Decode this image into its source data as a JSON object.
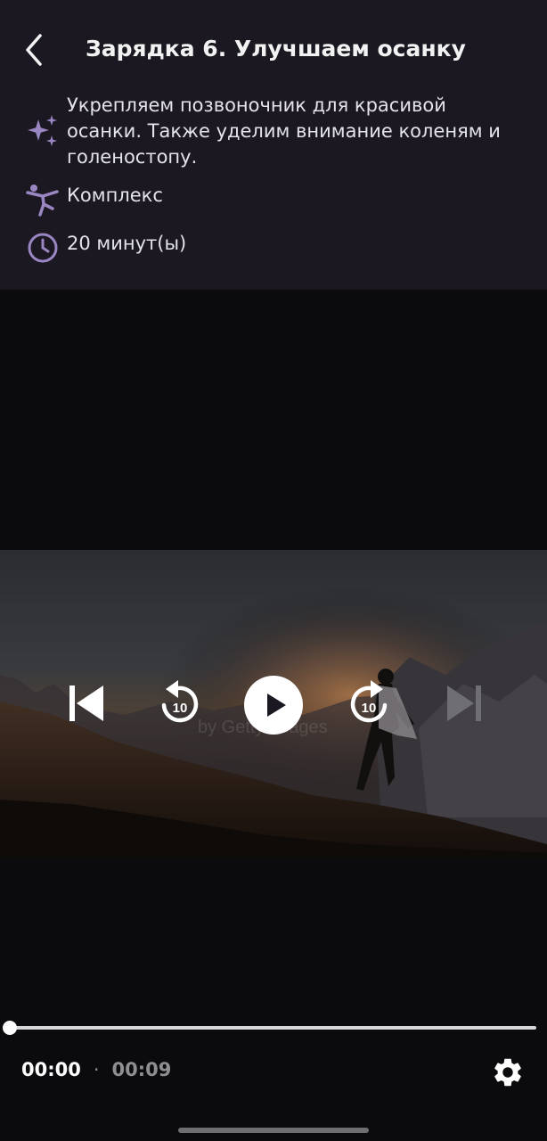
{
  "header": {
    "title": "Зарядка 6. Улучшаем осанку",
    "back_icon": "chevron-left-icon"
  },
  "info": {
    "description": "Укрепляем позвоночник для красивой осанки. Также уделим внимание коленям и голеностопу.",
    "category": "Комплекс",
    "duration": "20 минут(ы)",
    "accent_color": "#9b86c4"
  },
  "video": {
    "watermark": "by Getty Images",
    "controls": {
      "previous_icon": "skip-previous-icon",
      "rewind_icon": "replay-10-icon",
      "rewind_label": "10",
      "play_icon": "play-icon",
      "forward_icon": "forward-10-icon",
      "forward_label": "10",
      "next_icon": "skip-next-icon"
    }
  },
  "player": {
    "current_time": "00:00",
    "separator": "·",
    "total_time": "00:09",
    "progress": 0,
    "settings_icon": "gear-icon"
  }
}
